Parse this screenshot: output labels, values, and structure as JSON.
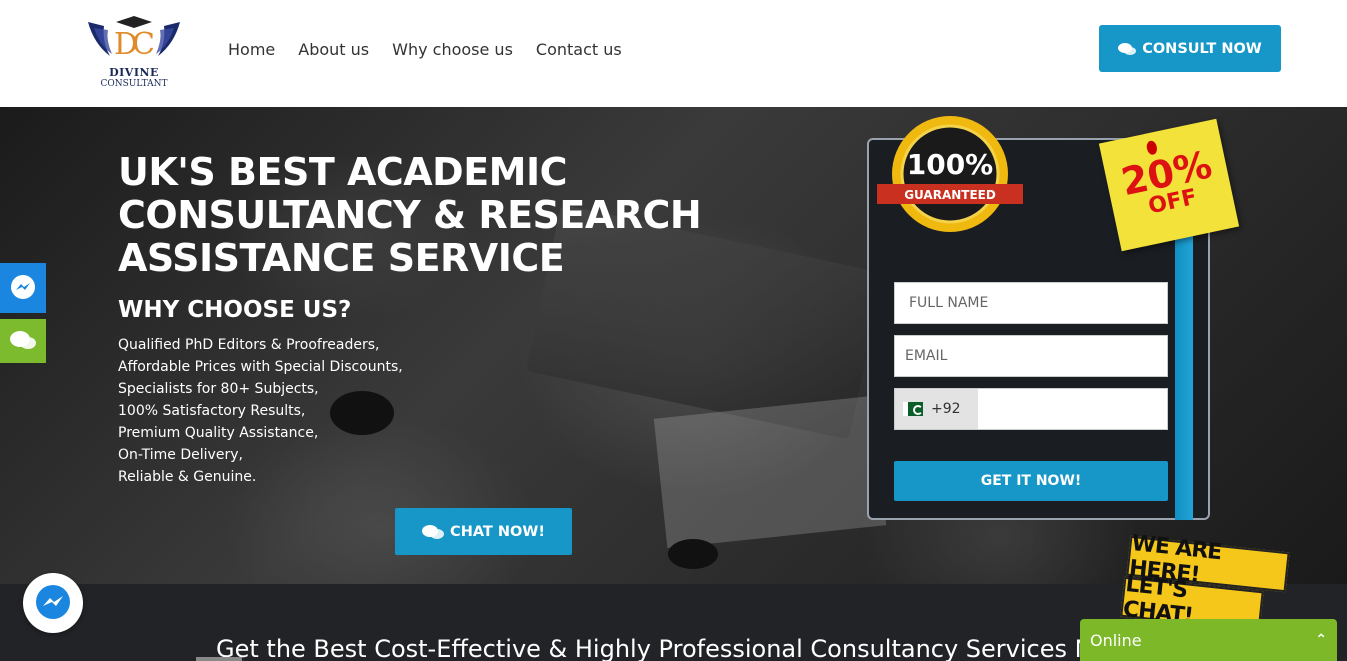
{
  "logo": {
    "line1": "DIVINE",
    "line2": "CONSULTANT",
    "monogram": "DC"
  },
  "nav": {
    "items": [
      "Home",
      "About us",
      "Why choose us",
      "Contact us"
    ]
  },
  "header": {
    "consult_label": "CONSULT NOW"
  },
  "hero": {
    "title": "UK'S BEST ACADEMIC CONSULTANCY & RESEARCH ASSISTANCE SERVICE",
    "why_title": "WHY CHOOSE US?",
    "features": [
      "Qualified PhD Editors & Proofreaders,",
      "Affordable Prices with Special Discounts,",
      "Specialists for 80+ Subjects,",
      "100% Satisfactory Results,",
      "Premium Quality Assistance,",
      "On-Time Delivery,",
      "Reliable & Genuine."
    ],
    "chat_label": "CHAT NOW!"
  },
  "form": {
    "badge_pct": "100%",
    "badge_label": "GUARANTEED",
    "offer_pct": "20%",
    "offer_off": "OFF",
    "name_placeholder": "FULL NAME",
    "email_placeholder": "EMAIL",
    "phone_code": "+92",
    "submit_label": "GET IT NOW!"
  },
  "bottom": {
    "heading": "Get the Best Cost-Effective & Highly Professional Consultancy Services N"
  },
  "chat_widget": {
    "sign_line1": "WE ARE HERE!",
    "sign_line2": "LET'S CHAT!",
    "status": "Online"
  },
  "colors": {
    "accent": "#1797c7",
    "green": "#7cb827",
    "messenger": "#1a86e0"
  }
}
